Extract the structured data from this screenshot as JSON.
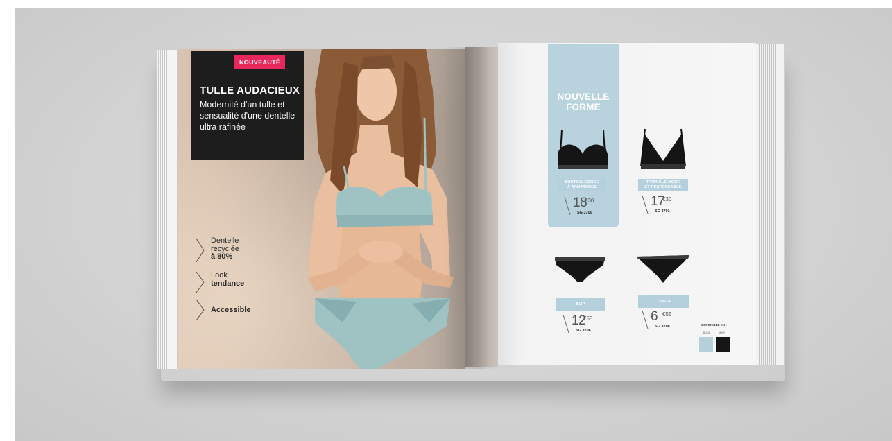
{
  "left_page": {
    "badge": "NOUVEAUTÉ",
    "title": "TULLE AUDACIEUX",
    "subtitle": "Modernité d'un tulle et sensualité d'une dentelle ultra rafinée",
    "features": [
      {
        "line1": "Dentelle",
        "line2": "recyclée",
        "bold": "à 80%"
      },
      {
        "line1": "Look",
        "line2": "",
        "bold": "tendance"
      },
      {
        "line1": "",
        "line2": "",
        "bold": "Accessible"
      }
    ]
  },
  "right_page": {
    "panel_title_line1": "NOUVELLE",
    "panel_title_line2": "FORME",
    "products": [
      {
        "label_line1": "SOUTIEN-GORGE",
        "label_line2": "À ARMATURES",
        "price_main": "18",
        "price_cents": "€30",
        "ref": "SG 3700"
      },
      {
        "label_line1": "TRIANGLE MODE",
        "label_line2": "ET RESPONSABLE",
        "price_main": "17",
        "price_cents": "€30",
        "ref": "SG 3701"
      },
      {
        "label_line1": "SLIP",
        "label_line2": "",
        "price_main": "12",
        "price_cents": "€55",
        "ref": "SG 3706"
      },
      {
        "label_line1": "TANGA",
        "label_line2": "",
        "price_main": "6",
        "price_cents": "€55",
        "ref": "SG 3708"
      }
    ],
    "available_label": "DISPONIBLE EN :",
    "swatches": [
      {
        "label": "BLEU",
        "color": "#b5d0da"
      },
      {
        "label": "NOIR",
        "color": "#161616"
      }
    ]
  },
  "colors": {
    "badge": "#e8275c",
    "black_box": "#1d1d1d",
    "blue_panel": "#b9d3de",
    "label_blue": "#b3d0dc"
  }
}
